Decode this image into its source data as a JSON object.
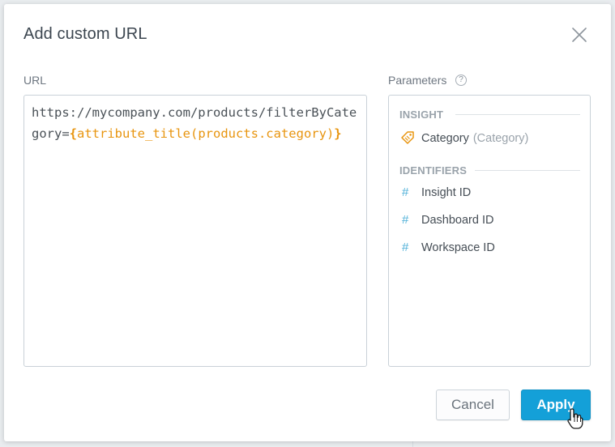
{
  "dialog": {
    "title": "Add custom URL",
    "close_icon": "close-icon"
  },
  "url": {
    "label": "URL",
    "value_plain": "https://mycompany.com/products/filterByCategory=",
    "token_open": "{",
    "token_text": "attribute_title(products.category)",
    "token_close": "}"
  },
  "parameters": {
    "label": "Parameters",
    "help_icon": "?",
    "sections": [
      {
        "heading": "INSIGHT",
        "items": [
          {
            "label": "Category",
            "sub": "(Category)",
            "icon": "attribute-tag-icon"
          }
        ]
      },
      {
        "heading": "IDENTIFIERS",
        "items": [
          {
            "label": "Insight ID",
            "icon": "#"
          },
          {
            "label": "Dashboard ID",
            "icon": "#"
          },
          {
            "label": "Workspace ID",
            "icon": "#"
          }
        ]
      }
    ]
  },
  "buttons": {
    "cancel": "Cancel",
    "apply": "Apply"
  },
  "colors": {
    "accent": "#14a0d8",
    "token": "#e8950f",
    "hash": "#4fb0d8"
  }
}
